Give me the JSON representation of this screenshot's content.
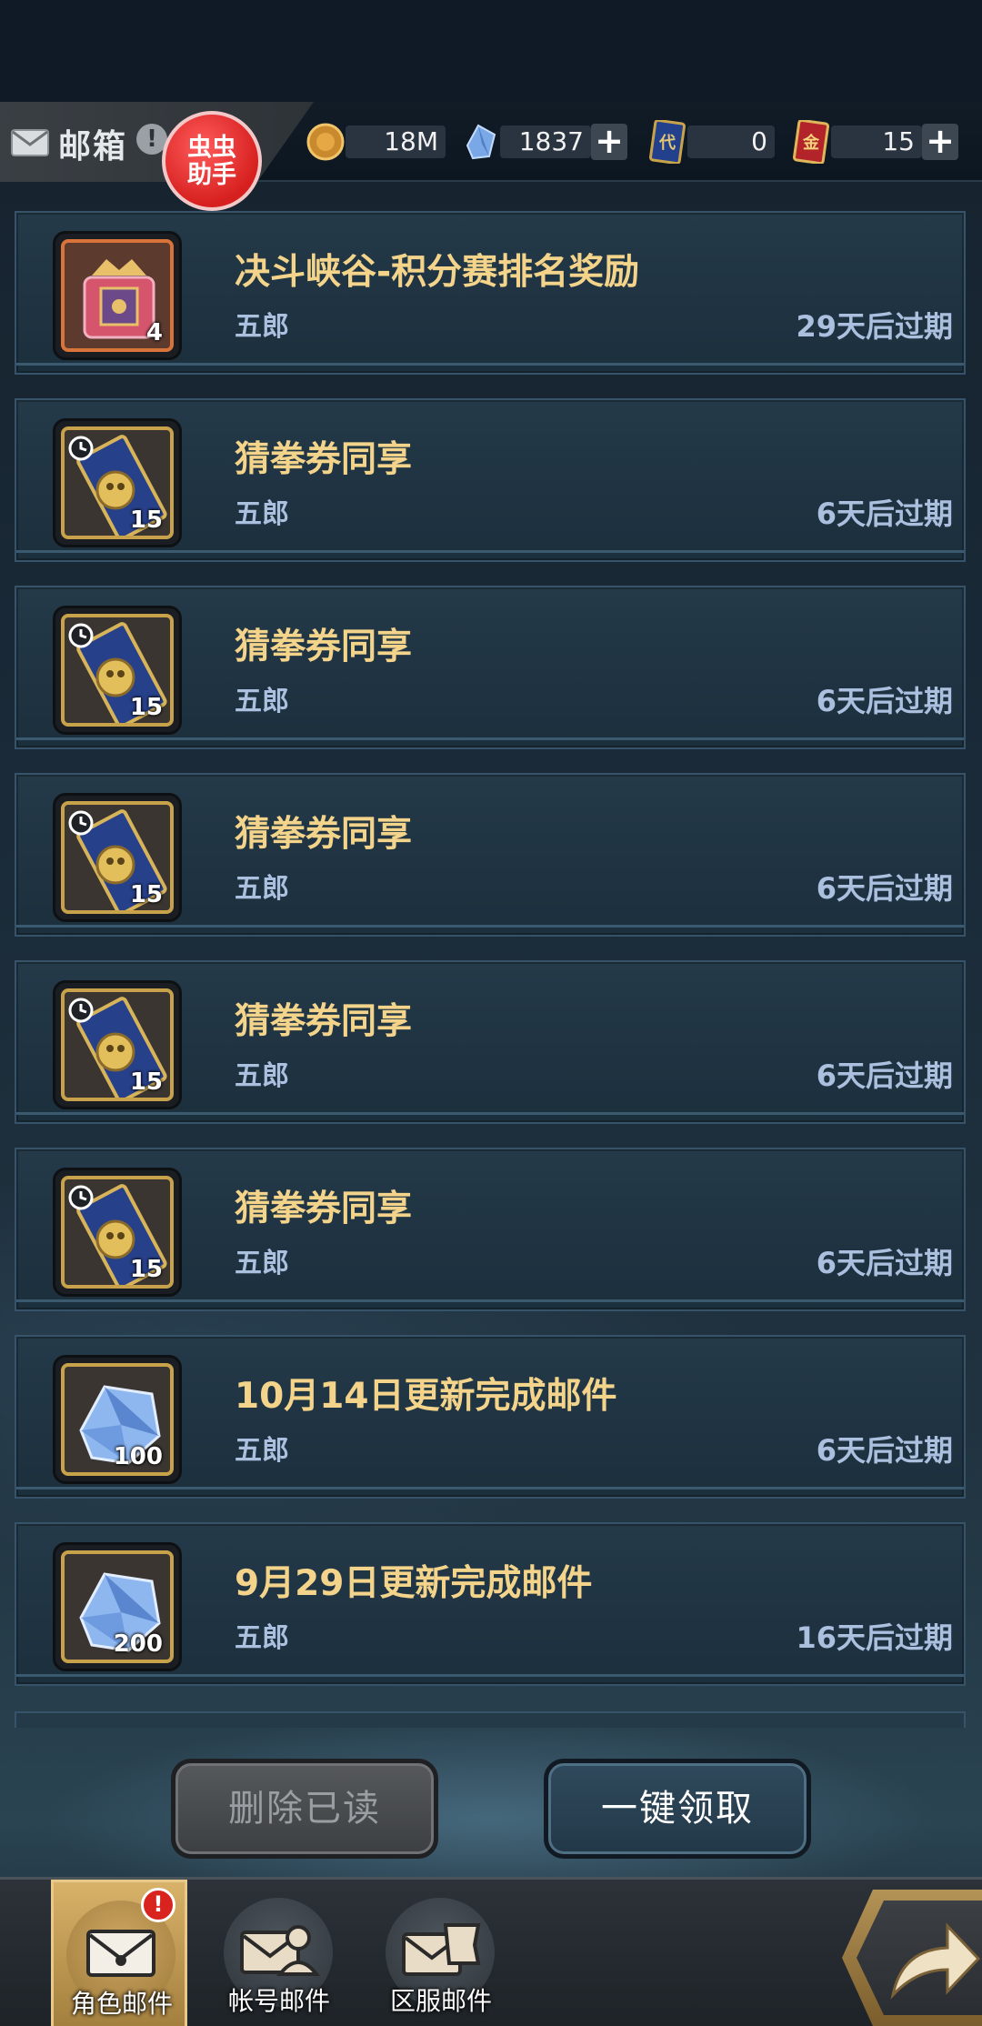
{
  "header": {
    "title": "邮箱",
    "warn_symbol": "!",
    "helper_badge": "虫虫\n助手",
    "resources": [
      {
        "name": "gold-coin",
        "value": "18M",
        "has_plus": false
      },
      {
        "name": "crystal",
        "value": "1837",
        "has_plus": true
      },
      {
        "name": "blue-ticket",
        "icon_text": "代",
        "value": "0",
        "has_plus": false
      },
      {
        "name": "red-ticket",
        "icon_text": "金",
        "value": "15",
        "has_plus": true
      }
    ],
    "plus_symbol": "+"
  },
  "mails": [
    {
      "subject": "决斗峡谷-积分赛排名奖励",
      "sender": "五郎",
      "expiry": "29天后过期",
      "item_icon": "trophy-chest-icon",
      "quantity": "4"
    },
    {
      "subject": "猜拳券同享",
      "sender": "五郎",
      "expiry": "6天后过期",
      "item_icon": "rps-ticket-icon",
      "quantity": "15"
    },
    {
      "subject": "猜拳券同享",
      "sender": "五郎",
      "expiry": "6天后过期",
      "item_icon": "rps-ticket-icon",
      "quantity": "15"
    },
    {
      "subject": "猜拳券同享",
      "sender": "五郎",
      "expiry": "6天后过期",
      "item_icon": "rps-ticket-icon",
      "quantity": "15"
    },
    {
      "subject": "猜拳券同享",
      "sender": "五郎",
      "expiry": "6天后过期",
      "item_icon": "rps-ticket-icon",
      "quantity": "15"
    },
    {
      "subject": "猜拳券同享",
      "sender": "五郎",
      "expiry": "6天后过期",
      "item_icon": "rps-ticket-icon",
      "quantity": "15"
    },
    {
      "subject": "10月14日更新完成邮件",
      "sender": "五郎",
      "expiry": "6天后过期",
      "item_icon": "crystal-icon",
      "quantity": "100"
    },
    {
      "subject": "9月29日更新完成邮件",
      "sender": "五郎",
      "expiry": "16天后过期",
      "item_icon": "crystal-icon",
      "quantity": "200"
    }
  ],
  "actions": {
    "delete_read": "删除已读",
    "claim_all": "一键领取"
  },
  "bottom_nav": {
    "tabs": [
      {
        "label": "角色邮件",
        "icon": "envelope-icon",
        "active": true,
        "warn": "!"
      },
      {
        "label": "帐号邮件",
        "icon": "account-mail-icon",
        "active": false
      },
      {
        "label": "区服邮件",
        "icon": "server-mail-icon",
        "active": false
      }
    ],
    "back_icon": "return-arrow-icon"
  },
  "colors": {
    "subject": "#f3d48a",
    "meta": "#aac0de",
    "accent_gold": "#c8a24a",
    "badge_red": "#d6201f"
  }
}
